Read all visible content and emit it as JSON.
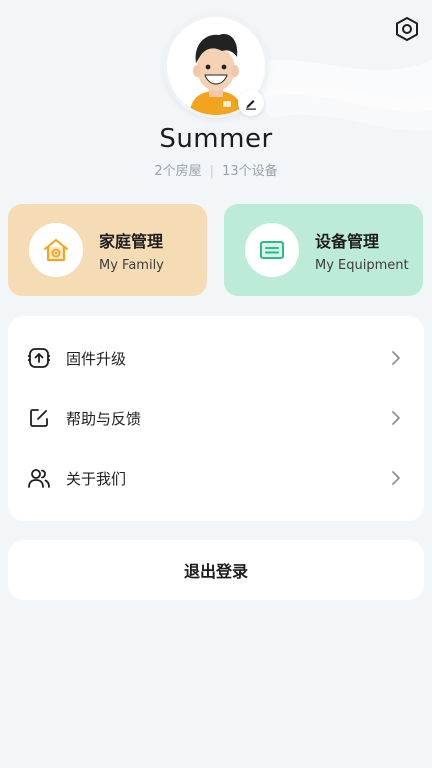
{
  "profile": {
    "name": "Summer",
    "rooms": "2个房屋",
    "devices": "13个设备",
    "separator": "|"
  },
  "cards": {
    "family": {
      "title": "家庭管理",
      "subtitle": "My Family",
      "icon": "home-icon",
      "bg": "#f6dcb4"
    },
    "equipment": {
      "title": "设备管理",
      "subtitle": "My Equipment",
      "icon": "device-card-icon",
      "bg": "#bcecd8"
    }
  },
  "menu": {
    "items": [
      {
        "label": "固件升级",
        "icon": "firmware-upgrade-icon"
      },
      {
        "label": "帮助与反馈",
        "icon": "feedback-edit-icon"
      },
      {
        "label": "关于我们",
        "icon": "users-icon"
      }
    ]
  },
  "logout": {
    "label": "退出登录"
  },
  "colors": {
    "accent_orange": "#f5a21b",
    "accent_green": "#2fb98a",
    "background": "#f3f6f9"
  }
}
